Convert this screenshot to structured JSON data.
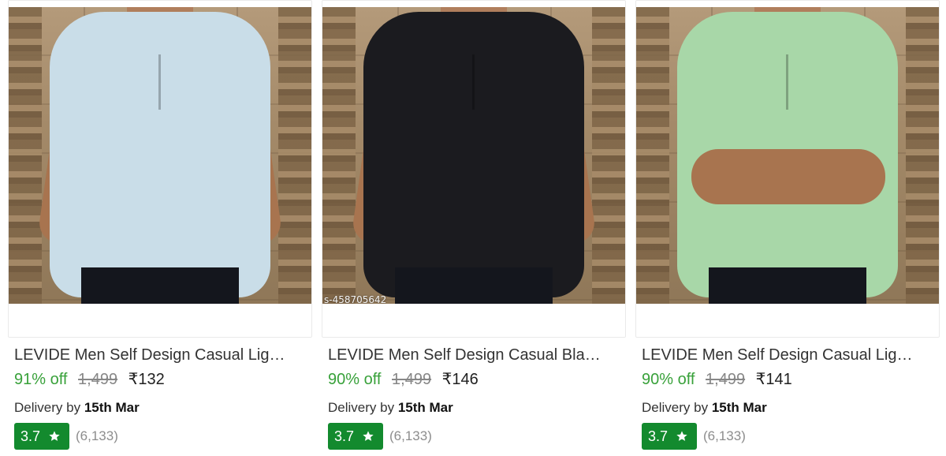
{
  "products": [
    {
      "title": "LEVIDE Men Self Design Casual Lig…",
      "discount": "91% off",
      "mrp": "1,499",
      "price": "₹132",
      "delivery_prefix": "Delivery by",
      "delivery_date": "15th Mar",
      "rating": "3.7",
      "rating_count": "(6,133)",
      "shirt_color": "#c9dde8",
      "image_label": "",
      "pose": "hands-on-hips"
    },
    {
      "title": "LEVIDE Men Self Design Casual Bla…",
      "discount": "90% off",
      "mrp": "1,499",
      "price": "₹146",
      "delivery_prefix": "Delivery by",
      "delivery_date": "15th Mar",
      "rating": "3.7",
      "rating_count": "(6,133)",
      "shirt_color": "#1b1b1f",
      "image_label": "s-458705642",
      "pose": "hands-on-hips"
    },
    {
      "title": "LEVIDE Men Self Design Casual Lig…",
      "discount": "90% off",
      "mrp": "1,499",
      "price": "₹141",
      "delivery_prefix": "Delivery by",
      "delivery_date": "15th Mar",
      "rating": "3.7",
      "rating_count": "(6,133)",
      "shirt_color": "#a8d7a8",
      "image_label": "",
      "pose": "arms-folded"
    }
  ],
  "colors": {
    "discount_green": "#38a13a",
    "rating_badge_green": "#138a2e",
    "mrp_gray": "#878787"
  },
  "icons": {
    "rating": "star-icon"
  }
}
